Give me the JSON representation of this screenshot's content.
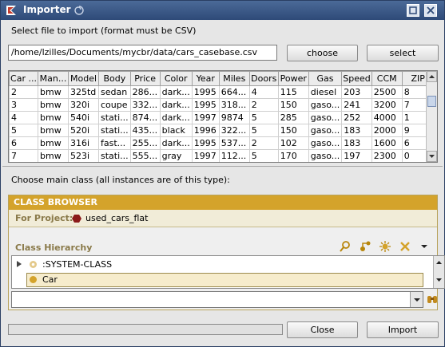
{
  "window": {
    "title": "Importer"
  },
  "file_section": {
    "label": "Select file to import (format must be CSV)",
    "path_value": "/home/lzilles/Documents/mycbr/data/cars_casebase.csv",
    "choose_label": "choose",
    "select_label": "select"
  },
  "table": {
    "columns": [
      "Car ...",
      "Man...",
      "Model",
      "Body",
      "Price",
      "Color",
      "Year",
      "Miles",
      "Doors",
      "Power",
      "Gas",
      "Speed",
      "CCM",
      "ZIP"
    ],
    "rows": [
      [
        "2",
        "bmw",
        "325td",
        "sedan",
        "286...",
        "dark...",
        "1995",
        "664...",
        "4",
        "115",
        "diesel",
        "203",
        "2500",
        "8"
      ],
      [
        "3",
        "bmw",
        "320i",
        "coupe",
        "332...",
        "dark...",
        "1995",
        "318...",
        "2",
        "150",
        "gaso...",
        "241",
        "3200",
        "7"
      ],
      [
        "4",
        "bmw",
        "540i",
        "stati...",
        "874...",
        "dark...",
        "1997",
        "9874",
        "5",
        "285",
        "gaso...",
        "252",
        "4000",
        "1"
      ],
      [
        "5",
        "bmw",
        "520i",
        "stati...",
        "435...",
        "black",
        "1996",
        "322...",
        "5",
        "150",
        "gaso...",
        "183",
        "2000",
        "9"
      ],
      [
        "6",
        "bmw",
        "316i",
        "fast...",
        "255...",
        "dark...",
        "1995",
        "537...",
        "2",
        "102",
        "gaso...",
        "183",
        "1600",
        "6"
      ],
      [
        "7",
        "bmw",
        "523i",
        "stati...",
        "555...",
        "gray",
        "1997",
        "112...",
        "5",
        "170",
        "gaso...",
        "197",
        "2300",
        "0"
      ]
    ]
  },
  "class_section": {
    "label": "Choose main class (all instances are of this type):",
    "browser_title": "CLASS BROWSER",
    "project_label": "For Project:",
    "project_name": "used_cars_flat",
    "hierarchy_label": "Class Hierarchy",
    "tree": [
      {
        "label": ":SYSTEM-CLASS",
        "selected": false
      },
      {
        "label": "Car",
        "selected": true
      }
    ],
    "search_value": ""
  },
  "footer": {
    "close_label": "Close",
    "import_label": "Import"
  },
  "colors": {
    "title_bar": "#3b5a88",
    "browser_header": "#d4a32b",
    "project_icon": "#8b1a1a",
    "class_icon": "#d4a32b",
    "selected_row": "#f6eccc"
  }
}
